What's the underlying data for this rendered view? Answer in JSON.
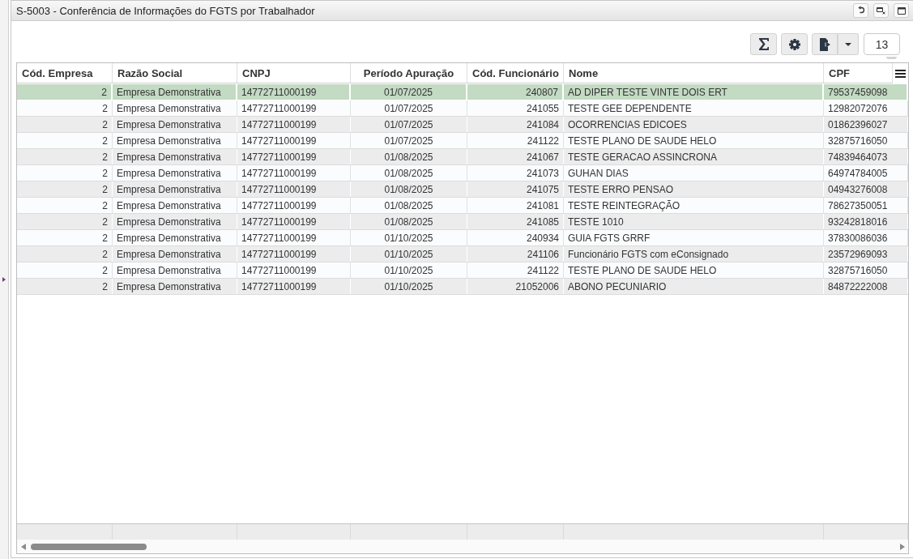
{
  "window": {
    "title": "S-5003 - Conferência de Informações do FGTS por Trabalhador"
  },
  "toolbar": {
    "record_count": "13"
  },
  "table": {
    "columns": [
      {
        "label": "Cód. Empresa",
        "kind": "number"
      },
      {
        "label": "Razão Social",
        "kind": "text"
      },
      {
        "label": "CNPJ",
        "kind": "text"
      },
      {
        "label": "Período Apuração",
        "kind": "date"
      },
      {
        "label": "Cód. Funcionário",
        "kind": "number"
      },
      {
        "label": "Nome",
        "kind": "text"
      },
      {
        "label": "CPF",
        "kind": "text"
      }
    ],
    "rows": [
      {
        "selected": true,
        "cells": [
          "2",
          "Empresa Demonstrativa",
          "14772711000199",
          "01/07/2025",
          "240807",
          "AD DIPER TESTE VINTE DOIS ERT",
          "79537459098"
        ]
      },
      {
        "selected": false,
        "cells": [
          "2",
          "Empresa Demonstrativa",
          "14772711000199",
          "01/07/2025",
          "241055",
          "TESTE GEE DEPENDENTE",
          "12982072076"
        ]
      },
      {
        "selected": false,
        "cells": [
          "2",
          "Empresa Demonstrativa",
          "14772711000199",
          "01/07/2025",
          "241084",
          "OCORRENCIAS EDICOES",
          "01862396027"
        ]
      },
      {
        "selected": false,
        "cells": [
          "2",
          "Empresa Demonstrativa",
          "14772711000199",
          "01/07/2025",
          "241122",
          "TESTE PLANO DE SAUDE HELO",
          "32875716050"
        ]
      },
      {
        "selected": false,
        "cells": [
          "2",
          "Empresa Demonstrativa",
          "14772711000199",
          "01/08/2025",
          "241067",
          "TESTE GERACAO ASSINCRONA",
          "74839464073"
        ]
      },
      {
        "selected": false,
        "cells": [
          "2",
          "Empresa Demonstrativa",
          "14772711000199",
          "01/08/2025",
          "241073",
          "GUHAN DIAS",
          "64974784005"
        ]
      },
      {
        "selected": false,
        "cells": [
          "2",
          "Empresa Demonstrativa",
          "14772711000199",
          "01/08/2025",
          "241075",
          "TESTE ERRO PENSAO",
          "04943276008"
        ]
      },
      {
        "selected": false,
        "cells": [
          "2",
          "Empresa Demonstrativa",
          "14772711000199",
          "01/08/2025",
          "241081",
          "TESTE REINTEGRAÇÃO",
          "78627350051"
        ]
      },
      {
        "selected": false,
        "cells": [
          "2",
          "Empresa Demonstrativa",
          "14772711000199",
          "01/08/2025",
          "241085",
          "TESTE 1010",
          "93242818016"
        ]
      },
      {
        "selected": false,
        "cells": [
          "2",
          "Empresa Demonstrativa",
          "14772711000199",
          "01/10/2025",
          "240934",
          "GUIA FGTS GRRF",
          "37830086036"
        ]
      },
      {
        "selected": false,
        "cells": [
          "2",
          "Empresa Demonstrativa",
          "14772711000199",
          "01/10/2025",
          "241106",
          "Funcionário FGTS com eConsignado",
          "23572969093"
        ]
      },
      {
        "selected": false,
        "cells": [
          "2",
          "Empresa Demonstrativa",
          "14772711000199",
          "01/10/2025",
          "241122",
          "TESTE PLANO DE SAUDE HELO",
          "32875716050"
        ]
      },
      {
        "selected": false,
        "cells": [
          "2",
          "Empresa Demonstrativa",
          "14772711000199",
          "01/10/2025",
          "21052006",
          "ABONO PECUNIARIO",
          "84872222008"
        ]
      }
    ]
  }
}
